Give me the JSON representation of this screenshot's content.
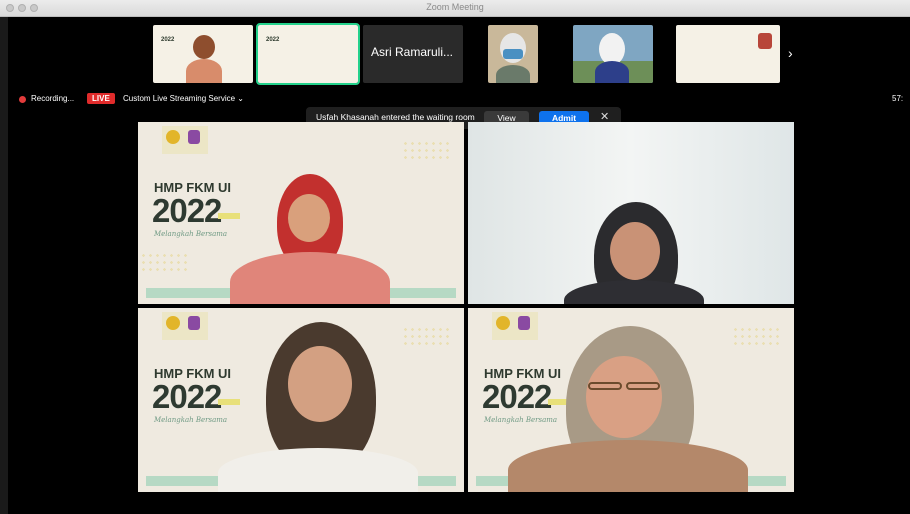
{
  "window": {
    "title": "Zoom Meeting"
  },
  "thumbnails": [
    {
      "type": "slide",
      "year": "2022"
    },
    {
      "type": "slide",
      "year": "2022"
    },
    {
      "type": "name",
      "name": "Asri Ramaruli..."
    },
    {
      "type": "video"
    },
    {
      "type": "video"
    },
    {
      "type": "slide"
    }
  ],
  "status": {
    "recording_label": "Recording...",
    "live_label": "LIVE",
    "stream_label": "Custom Live Streaming Service",
    "timer": "57:"
  },
  "waiting_room": {
    "message": "Usfah Khasanah entered the waiting room",
    "view_label": "View",
    "admit_label": "Admit"
  },
  "tiles": [
    {
      "background": "slide",
      "hmp": "HMP FKM UI",
      "year": "2022",
      "tagline": "Melangkah Bersama"
    },
    {
      "background": "plain"
    },
    {
      "background": "slide",
      "hmp": "HMP FKM UI",
      "year": "2022",
      "tagline": "Melangkah Bersama"
    },
    {
      "background": "slide",
      "hmp": "HMP FKM UI",
      "year": "2022",
      "tagline": "Melangkah Bersama"
    }
  ],
  "colors": {
    "admit": "#0e72ed",
    "live": "#e02b2b",
    "active_speaker": "#23d18b"
  }
}
